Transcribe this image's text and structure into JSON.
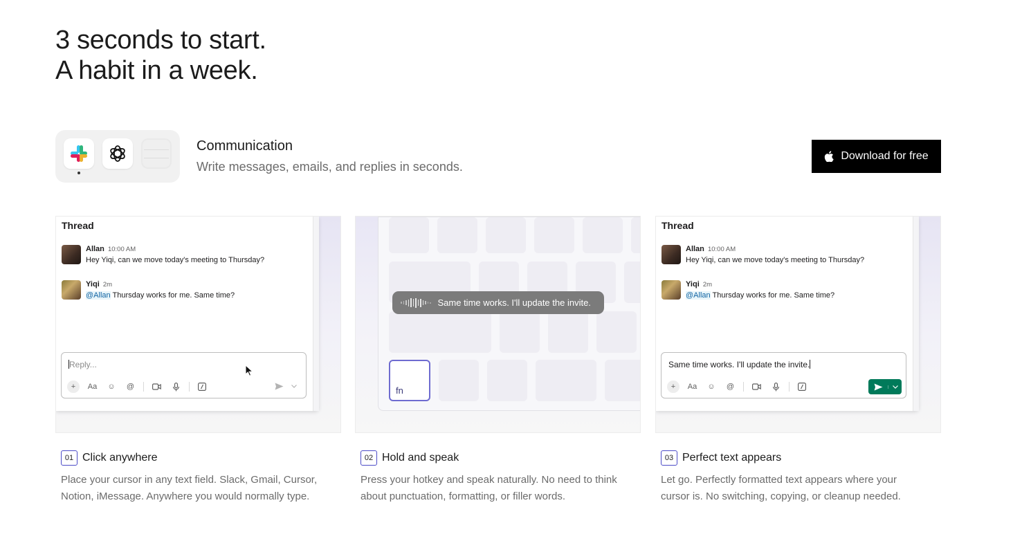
{
  "headline": {
    "line1": "3 seconds to start.",
    "line2": "A habit in a week."
  },
  "category": {
    "apps": [
      "slack-icon",
      "chatgpt-icon",
      "notes-icon"
    ],
    "title": "Communication",
    "subtitle": "Write messages, emails, and replies in seconds."
  },
  "download": {
    "label": "Download for free",
    "icon": "apple-icon"
  },
  "thread": {
    "title": "Thread",
    "messages": [
      {
        "name": "Allan",
        "time": "10:00 AM",
        "text": "Hey Yiqi, can we move today's meeting to Thursday?"
      },
      {
        "name": "Yiqi",
        "time": "2m",
        "mention": "@Allan",
        "text": " Thursday works for me. Same time?"
      }
    ],
    "placeholder": "Reply...",
    "typed_text": "Same time works. I'll update the invite."
  },
  "keyboard": {
    "fn_label": "fn",
    "transcript": "Same time works. I'll update the invite."
  },
  "steps": [
    {
      "num": "01",
      "title": "Click anywhere",
      "desc": "Place your cursor in any text field. Slack, Gmail, Cursor, Notion, iMessage. Anywhere you would normally type."
    },
    {
      "num": "02",
      "title": "Hold and speak",
      "desc": "Press your hotkey and speak naturally. No need to think about punctuation, formatting, or filler words."
    },
    {
      "num": "03",
      "title": "Perfect text appears",
      "desc": "Let go. Perfectly formatted text appears where your cursor is. No switching, copying, or cleanup needed."
    }
  ],
  "colors": {
    "accent": "#4b4bc7",
    "send_green": "#007a5a",
    "mention": "#1264a3"
  }
}
